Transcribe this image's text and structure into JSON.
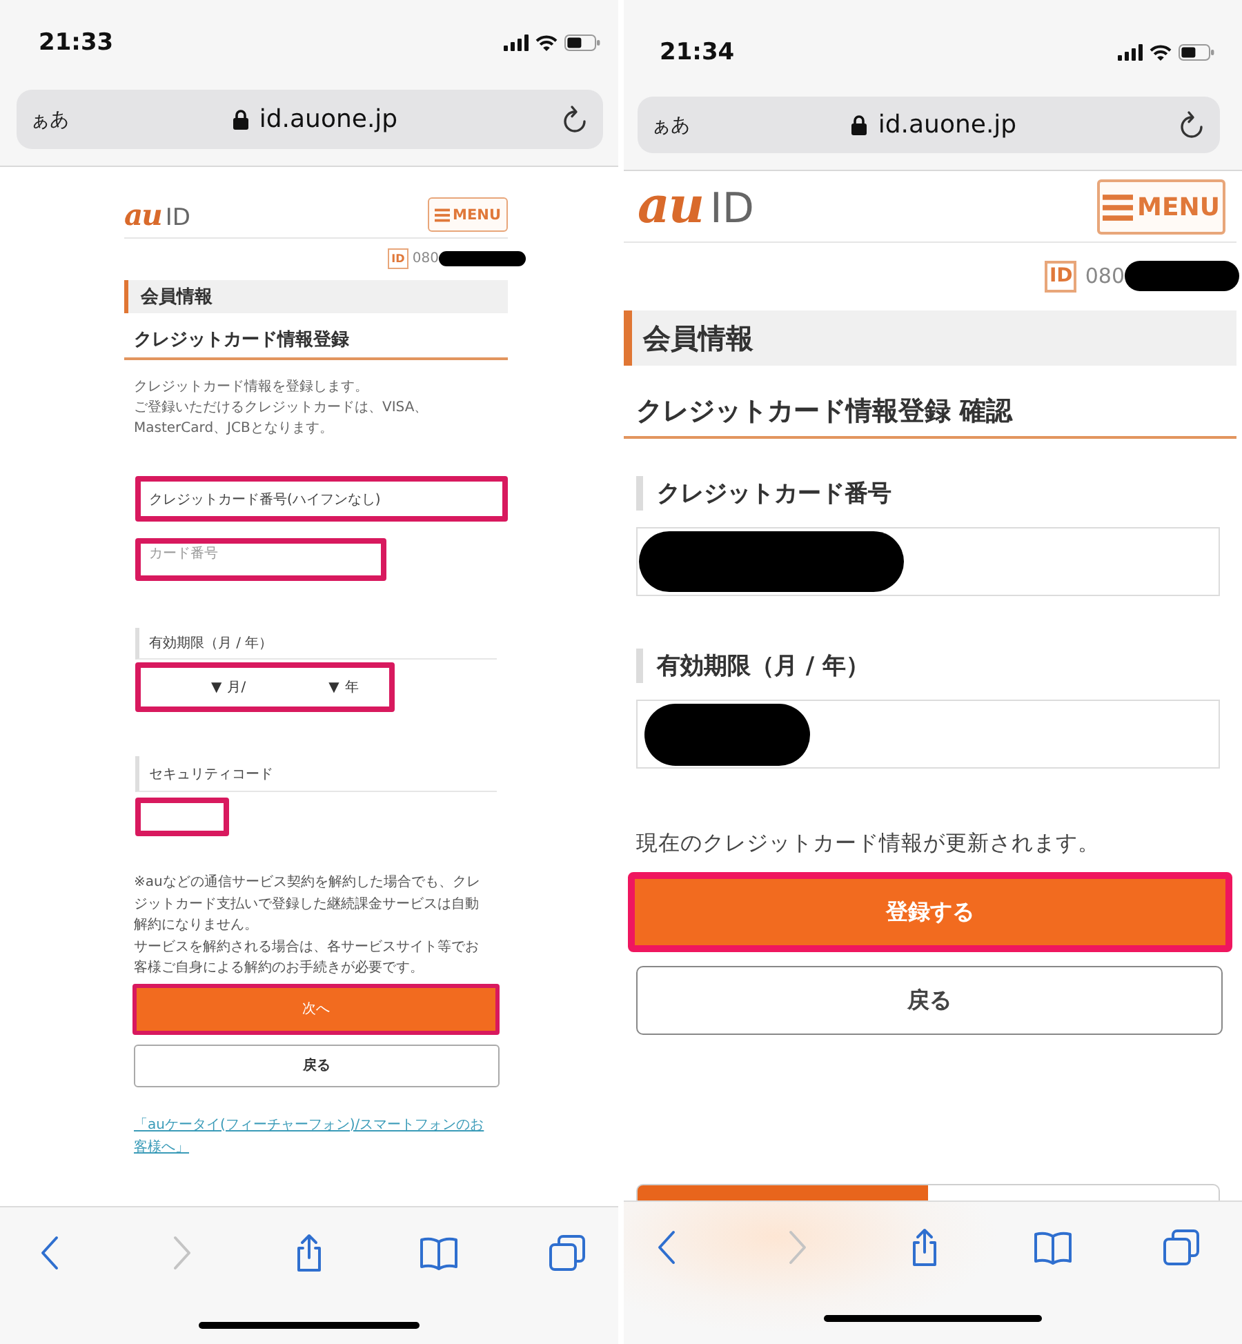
{
  "screens": [
    {
      "kind": "entry_form",
      "status_bar": {
        "time": "21:33"
      },
      "address_bar": {
        "text_size": "ぁあ",
        "url": "id.auone.jp"
      },
      "header": {
        "logo_mark": "au",
        "logo_text": "ID",
        "menu": "MENU"
      },
      "account": {
        "badge": "ID",
        "number": "080",
        "redacted": true
      },
      "section_title": "会員情報",
      "page_title": "クレジットカード情報登録",
      "intro": [
        "クレジットカード情報を登録します。",
        "ご登録いただけるクレジットカードは、VISA、",
        "MasterCard、JCBとなります。"
      ],
      "card_number": {
        "label": "クレジットカード番号(ハイフンなし)",
        "label_highlighted": true,
        "placeholder": "カード番号",
        "highlighted": true
      },
      "expiry": {
        "label": "有効期限（月 / 年）",
        "selects": [
          {
            "arrow": "▼",
            "unit": "月/"
          },
          {
            "arrow": "▼",
            "unit": "年"
          }
        ],
        "highlighted": true
      },
      "security_code": {
        "label": "セキュリティコード",
        "highlighted": true
      },
      "note": [
        "※auなどの通信サービス契約を解約した場合でも、クレ",
        "ジットカード支払いで登録した継続課金サービスは自動",
        "解約になりません。",
        "サービスを解約される場合は、各サービスサイト等でお",
        "客様ご自身による解約のお手続きが必要です。"
      ],
      "buttons": [
        {
          "label": "次へ",
          "kind": "primary",
          "highlighted": true
        },
        {
          "label": "戻る",
          "kind": "secondary",
          "highlighted": false
        }
      ],
      "link": [
        "「auケータイ(フィーチャーフォン)/スマートフォンのお",
        "客様へ」"
      ],
      "toolbar": [
        {
          "kind": "back",
          "disabled": false
        },
        {
          "kind": "forward",
          "disabled": true
        },
        {
          "kind": "share",
          "disabled": false
        },
        {
          "kind": "bookmarks",
          "disabled": false
        },
        {
          "kind": "tabs",
          "disabled": false
        }
      ]
    },
    {
      "kind": "confirmation",
      "status_bar": {
        "time": "21:34"
      },
      "address_bar": {
        "text_size": "ぁあ",
        "url": "id.auone.jp"
      },
      "header": {
        "logo_mark": "au",
        "logo_text": "ID",
        "menu": "MENU"
      },
      "account": {
        "badge": "ID",
        "number": "080",
        "redacted": true
      },
      "section_title": "会員情報",
      "page_title": "クレジットカード情報登録 確認",
      "fields": [
        {
          "label": "クレジットカード番号",
          "redacted": true
        },
        {
          "label": "有効期限（月 / 年）",
          "redacted": true
        }
      ],
      "notice": "現在のクレジットカード情報が更新されます。",
      "buttons": [
        {
          "label": "登録する",
          "kind": "primary",
          "highlighted": true
        },
        {
          "label": "戻る",
          "kind": "secondary",
          "highlighted": false
        }
      ],
      "toolbar": [
        {
          "kind": "back",
          "disabled": false
        },
        {
          "kind": "forward",
          "disabled": true
        },
        {
          "kind": "share",
          "disabled": false
        },
        {
          "kind": "bookmarks",
          "disabled": false
        },
        {
          "kind": "tabs",
          "disabled": false
        }
      ]
    }
  ]
}
